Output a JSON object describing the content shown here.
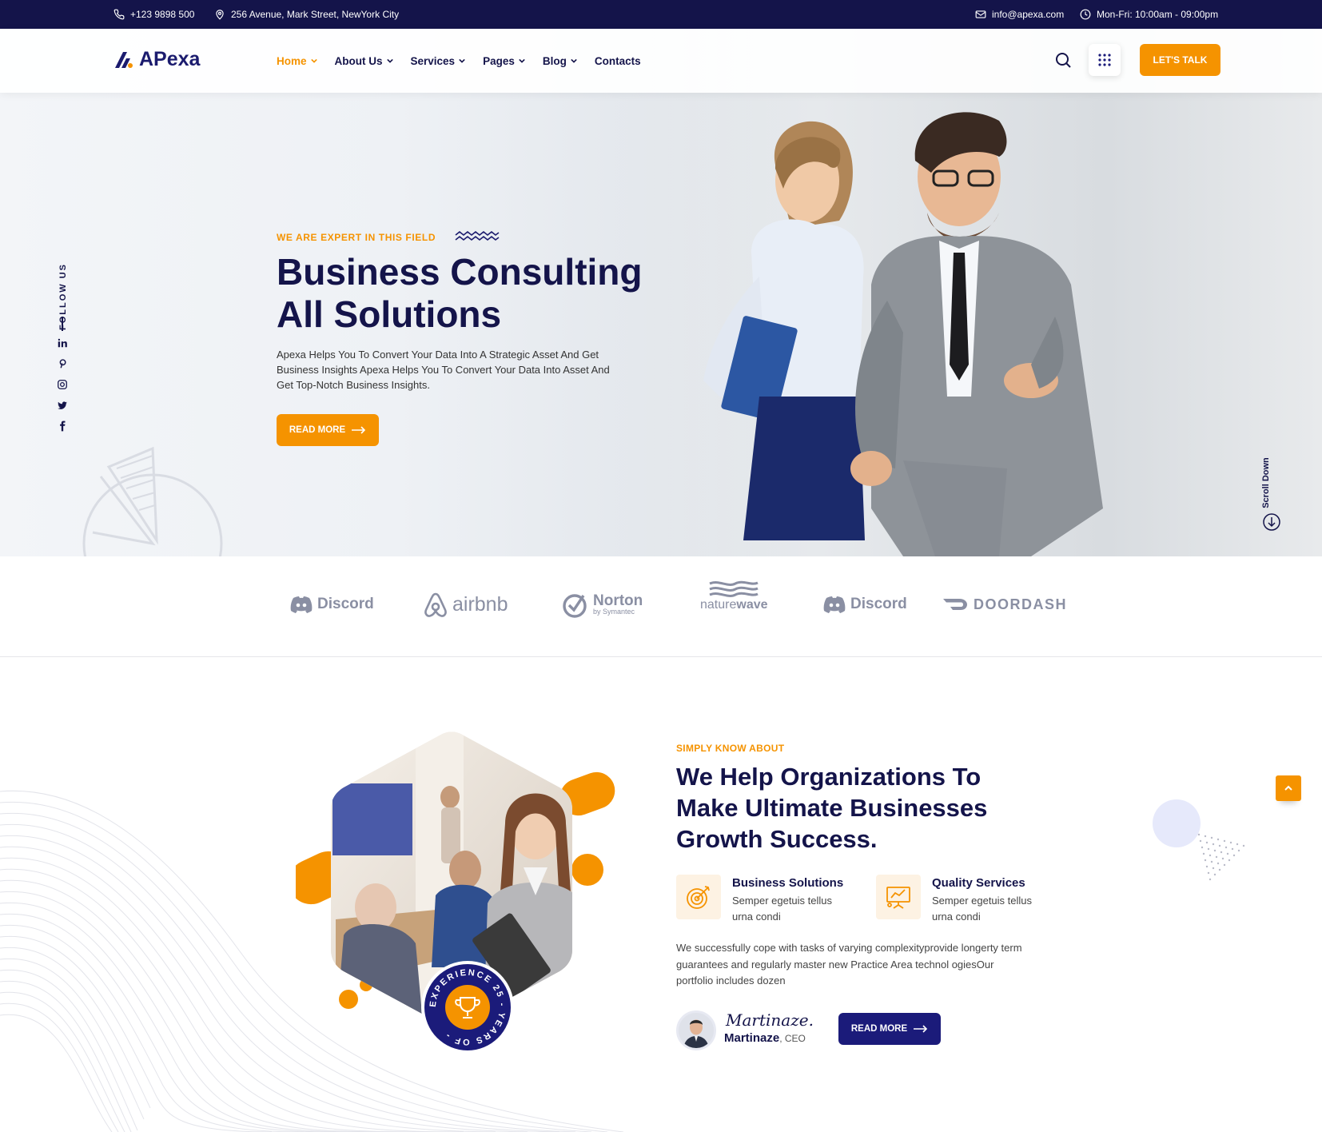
{
  "topbar": {
    "phone": "+123 9898 500",
    "address": "256 Avenue, Mark Street, NewYork City",
    "email": "info@apexa.com",
    "hours": "Mon-Fri: 10:00am - 09:00pm"
  },
  "header": {
    "logo": "APexa",
    "nav": [
      "Home",
      "About Us",
      "Services",
      "Pages",
      "Blog",
      "Contacts"
    ],
    "cta": "LET'S TALK"
  },
  "hero": {
    "follow": "FOLLOW US",
    "tagline": "WE ARE EXPERT IN THIS FIELD",
    "title_line1": "Business Consulting",
    "title_line2": "All Solutions",
    "description": "Apexa Helps You To Convert Your Data Into A Strategic Asset And Get Business Insights Apexa Helps You To Convert Your Data Into Asset And Get Top-Notch Business Insights.",
    "button": "READ MORE",
    "scroll": "Scroll Down"
  },
  "brands": {
    "items": [
      "Discord",
      "airbnb",
      "Norton",
      "naturewave",
      "Discord",
      "DOORDASH"
    ],
    "norton_sub": "by Symantec",
    "naturewave_parts": [
      "nature",
      "wave"
    ]
  },
  "about": {
    "tag": "SIMPLY KNOW ABOUT",
    "title": "We Help Organizations To Make Ultimate Businesses Growth Success.",
    "features": [
      {
        "title": "Business Solutions",
        "desc": "Semper egetuis tellus urna condi",
        "icon": "target-icon"
      },
      {
        "title": "Quality Services",
        "desc": "Semper egetuis tellus urna condi",
        "icon": "presentation-icon"
      }
    ],
    "description": "We successfully cope with tasks of varying complexityprovide longerty term guarantees and regularly master new Practice Area technol ogiesOur portfolio includes dozen",
    "signature": "Martinaze.",
    "author_name": "Martinaze",
    "author_role": ", CEO",
    "button": "READ MORE",
    "badge": "EXPERIENCE 25 - YEARS OF - "
  },
  "colors": {
    "navy": "#14144a",
    "orange": "#f59300",
    "button_navy": "#1b1b7a"
  }
}
